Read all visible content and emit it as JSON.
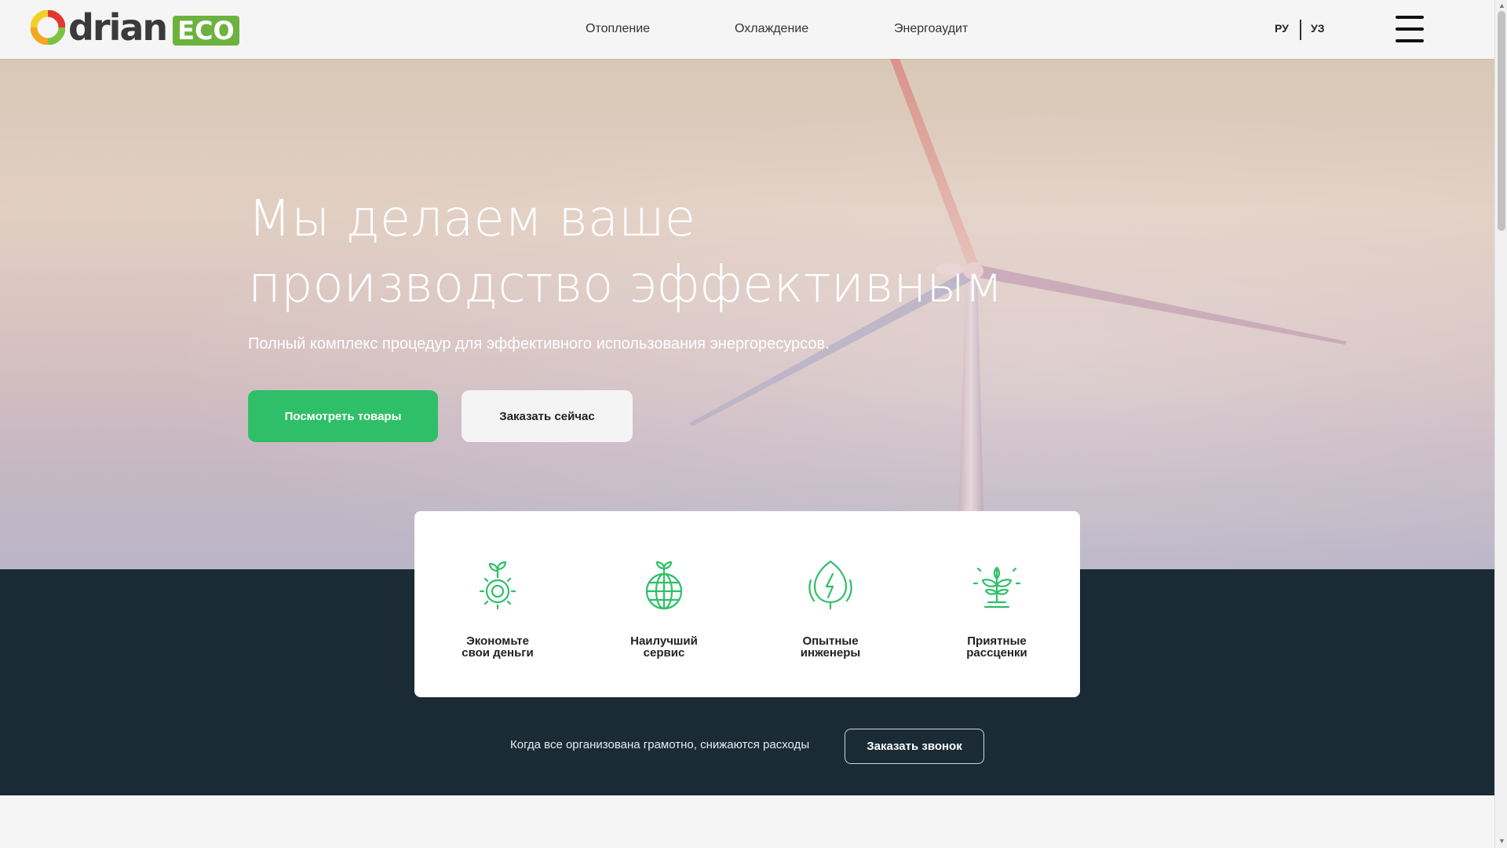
{
  "header": {
    "logo_text": "drian",
    "logo_badge": "ECO",
    "nav": [
      "Отопление",
      "Охлаждение",
      "Энергоаудит"
    ],
    "lang_ru": "РУ",
    "lang_uz": "УЗ"
  },
  "hero": {
    "title_line1": "Мы делаем ваше",
    "title_line2": "производство эффективным",
    "subtitle": "Полный комплекс процедур для эффективного использования энергоресурсов.",
    "btn_products": "Посмотреть товары",
    "btn_order": "Заказать сейчас"
  },
  "features": [
    {
      "line1": "Экономьте",
      "line2": "свои деньги",
      "icon": "gear-sprout-icon"
    },
    {
      "line1": "Наилучший",
      "line2": "сервис",
      "icon": "globe-sprout-icon"
    },
    {
      "line1": "Опытные",
      "line2": "инженеры",
      "icon": "leaf-bolt-icon"
    },
    {
      "line1": "Приятные",
      "line2": "рассценки",
      "icon": "plant-icon"
    }
  ],
  "cta": {
    "text": "Когда все организована грамотно, снижаются расходы",
    "button": "Заказать звонок"
  },
  "colors": {
    "accent_green": "#2fbf68",
    "dark_band": "#1a2b36",
    "logo_green": "#6bb33e"
  }
}
